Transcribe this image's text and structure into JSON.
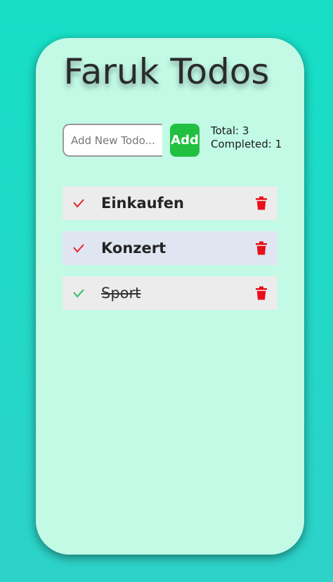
{
  "app": {
    "title": "Faruk Todos"
  },
  "form": {
    "input_value": "",
    "input_placeholder": "Add New Todo...",
    "add_label": "Add"
  },
  "stats": {
    "total_text": "Total: 3",
    "completed_text": "Completed: 1"
  },
  "todos": [
    {
      "text": "Einkaufen",
      "completed": false,
      "check_icon": "check-icon",
      "delete_icon": "trash-icon"
    },
    {
      "text": "Konzert",
      "completed": false,
      "check_icon": "check-icon",
      "delete_icon": "trash-icon"
    },
    {
      "text": "Sport",
      "completed": true,
      "check_icon": "check-icon",
      "delete_icon": "trash-icon"
    }
  ],
  "colors": {
    "background": "#16dfc6",
    "card": "#c2fae6",
    "add_button": "#21c040",
    "check_incomplete": "#e8202a",
    "check_complete": "#2cc064",
    "delete_icon": "#e8101a",
    "item_background": "#ececec",
    "item_highlight": "#dfe6f2"
  }
}
